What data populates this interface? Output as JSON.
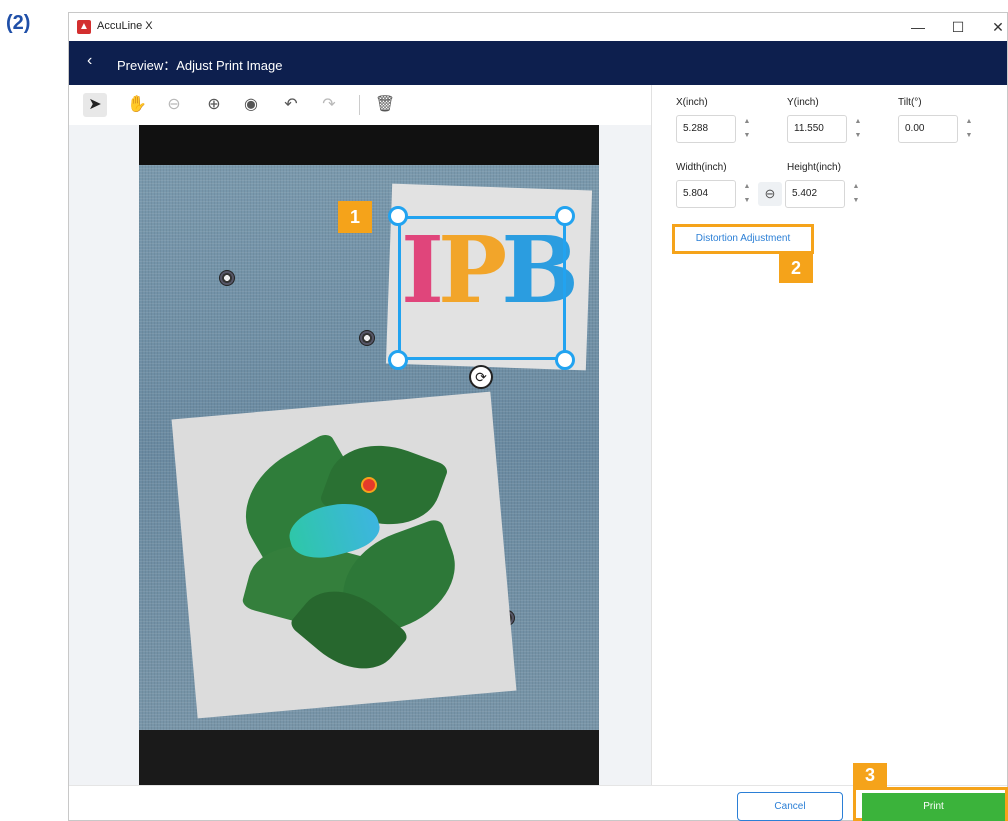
{
  "step_label": "(2)",
  "app": {
    "title": "AccuLine X",
    "logo_icon": "app-logo-icon"
  },
  "window_controls": {
    "minimize": "—",
    "maximize": "☐",
    "close": "✕"
  },
  "header": {
    "back_glyph": "‹",
    "title": "Preview：Adjust Print Image",
    "background": "#0d1f4e"
  },
  "toolbar": {
    "select": "➤",
    "pan": "✋",
    "zoom_out": "⊖",
    "zoom_in": "⊕",
    "preview": "◉",
    "undo": "↶",
    "redo": "↷",
    "delete": "🗑"
  },
  "design": {
    "letter_1": "I",
    "letter_2": "P",
    "letter_3": "B",
    "rotate_glyph": "⟳"
  },
  "markers": {
    "m1": "1",
    "m2": "2",
    "m3": "3"
  },
  "properties": {
    "x_label": "X(inch)",
    "x_value": "5.288",
    "y_label": "Y(inch)",
    "y_value": "11.550",
    "tilt_label": "Tilt(°)",
    "tilt_value": "0.00",
    "width_label": "Width(inch)",
    "width_value": "5.804",
    "height_label": "Height(inch)",
    "height_value": "5.402",
    "link_glyph": "⊖",
    "distortion_label": "Distortion Adjustment"
  },
  "stepper": {
    "up": "▲",
    "down": "▼"
  },
  "footer": {
    "cancel_label": "Cancel",
    "print_label": "Print"
  },
  "colors": {
    "accent": "#22a3f0",
    "marker": "#f5a31a",
    "print": "#3bb33b",
    "link": "#2b7fd6"
  }
}
